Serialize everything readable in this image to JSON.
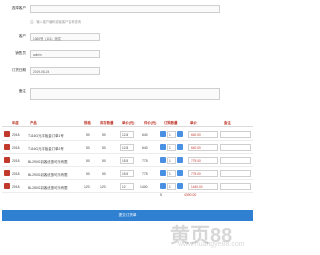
{
  "form": {
    "customer_label": "选择客户",
    "customer_note": "注：输入客户编码或者客户名称查询",
    "client_label": "客户",
    "client_value": "1360号（111）测试",
    "sales_label": "销售员",
    "sales_value": "admin",
    "date_label": "订货日期",
    "date_value": "2019-08-24",
    "remark_label": "备注"
  },
  "table": {
    "headers": [
      "年度",
      "产品",
      "规格",
      "库存数量",
      "单价(元)",
      "件价(元)",
      "订购数量",
      "单价",
      "备注"
    ],
    "rows": [
      {
        "year": "2018",
        "product": "T116G元平板金订单1号",
        "spec": "50",
        "stock": "50",
        "price": "12.8",
        "box_price": "640",
        "qty": "1",
        "unit_price": "640.00"
      },
      {
        "year": "2018",
        "product": "T116G元平板金订单2号",
        "spec": "50",
        "stock": "50",
        "price": "12.8",
        "box_price": "640",
        "qty": "1",
        "unit_price": "640.00"
      },
      {
        "year": "2018",
        "product": "BL290G羽客优惠可乐有限",
        "spec": "50",
        "stock": "50",
        "price": "15.5",
        "box_price": "775",
        "qty": "1",
        "unit_price": "775.00"
      },
      {
        "year": "2018",
        "product": "BL290G羽客优惠可乐有限",
        "spec": "50",
        "stock": "50",
        "price": "15.5",
        "box_price": "775",
        "qty": "1",
        "unit_price": "775.00"
      },
      {
        "year": "2018",
        "product": "BL280G羽客优惠可乐有限",
        "spec": "120",
        "stock": "120",
        "price": "12",
        "box_price": "1440",
        "qty": "1",
        "unit_price": "1440.00"
      }
    ]
  },
  "summary": {
    "count": "5",
    "total": "4390.00"
  },
  "submit_label": "提交订货单",
  "watermark": "黄页88",
  "watermark_sub": "www.huangye88.com"
}
